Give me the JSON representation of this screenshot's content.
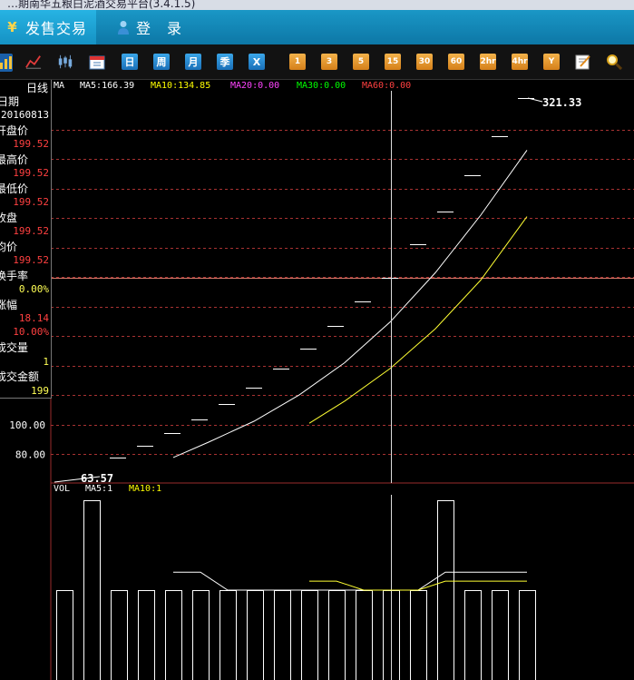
{
  "window": {
    "title": "…期南华五粮白泥酒交易平台(3.4.1.5)"
  },
  "tabs": [
    {
      "label": "发售交易",
      "icon": "yen-icon",
      "active": true
    },
    {
      "label": "登　录",
      "icon": "user-icon",
      "active": false
    }
  ],
  "toolbar": {
    "icons": [
      "bar-chart-icon",
      "line-chart-icon",
      "candlestick-icon",
      "calendar-icon"
    ],
    "period_buttons": [
      "日",
      "周",
      "月",
      "季",
      "X"
    ],
    "minute_buttons": [
      "1",
      "3",
      "5",
      "15",
      "30",
      "60",
      "2hr",
      "4hr",
      "Y"
    ],
    "tail_icons": [
      "edit-icon",
      "search-icon"
    ]
  },
  "info_panel": {
    "period": "日线",
    "fields": [
      {
        "label": "日期",
        "value": "20160813",
        "color": "white"
      },
      {
        "label": "开盘价",
        "value": "199.52",
        "color": "red"
      },
      {
        "label": "最高价",
        "value": "199.52",
        "color": "red"
      },
      {
        "label": "最低价",
        "value": "199.52",
        "color": "red"
      },
      {
        "label": "收盘",
        "value": "199.52",
        "color": "red"
      },
      {
        "label": "均价",
        "value": "199.52",
        "color": "red"
      },
      {
        "label": "换手率",
        "value": "0.00%",
        "color": "yellow"
      },
      {
        "label": "涨幅",
        "value": "18.14",
        "sub": "10.00%",
        "color": "red"
      },
      {
        "label": "成交量",
        "value": "1",
        "color": "yellow"
      },
      {
        "label": "成交金额",
        "value": "199",
        "color": "yellow"
      }
    ]
  },
  "ma_legend": [
    {
      "label": "MA",
      "color": "#ffffff"
    },
    {
      "label": "MA5:166.39",
      "color": "#ffffff"
    },
    {
      "label": "MA10:134.85",
      "color": "#ffff00"
    },
    {
      "label": "MA20:0.00",
      "color": "#ff44ff"
    },
    {
      "label": "MA30:0.00",
      "color": "#00ff00"
    },
    {
      "label": "MA60:0.00",
      "color": "#ff4040"
    }
  ],
  "vol_legend": [
    {
      "label": "VOL",
      "color": "#ffffff"
    },
    {
      "label": "MA5:1",
      "color": "#ffffff"
    },
    {
      "label": "MA10:1",
      "color": "#ffff00"
    }
  ],
  "chart_data": {
    "type": "line",
    "ylim": [
      63.57,
      321.33
    ],
    "y_ticks": [
      "80.00",
      "100.00"
    ],
    "max_label": "321.33",
    "min_label": "63.57",
    "price_bars": [
      {
        "x": 130,
        "close": 77.84
      },
      {
        "x": 160,
        "close": 85.62
      },
      {
        "x": 190,
        "close": 94.18
      },
      {
        "x": 220,
        "close": 103.6
      },
      {
        "x": 250,
        "close": 113.96
      },
      {
        "x": 280,
        "close": 125.36
      },
      {
        "x": 310,
        "close": 137.9
      },
      {
        "x": 340,
        "close": 151.69
      },
      {
        "x": 370,
        "close": 166.86
      },
      {
        "x": 400,
        "close": 183.54
      },
      {
        "x": 430,
        "close": 199.52
      },
      {
        "x": 461,
        "close": 222.1
      },
      {
        "x": 491,
        "close": 244.31
      },
      {
        "x": 521,
        "close": 268.74
      },
      {
        "x": 551,
        "close": 295.61
      },
      {
        "x": 580,
        "close": 321.33
      }
    ],
    "ma5": {
      "x": [
        191,
        230,
        280,
        330,
        380,
        430,
        480,
        530,
        581
      ],
      "y": [
        77.8,
        88.2,
        102.3,
        120.2,
        142.0,
        169.5,
        203.0,
        242.0,
        286.0
      ]
    },
    "ma10": {
      "x": [
        341,
        380,
        430,
        480,
        530,
        581
      ],
      "y": [
        101.0,
        116.0,
        138.0,
        165.0,
        198.0,
        241.0
      ]
    },
    "crosshair_x": 431,
    "volume": {
      "series": [
        {
          "x": 71,
          "v": 1
        },
        {
          "x": 101,
          "v": 2
        },
        {
          "x": 131,
          "v": 1
        },
        {
          "x": 161,
          "v": 1
        },
        {
          "x": 191,
          "v": 1
        },
        {
          "x": 221,
          "v": 1
        },
        {
          "x": 251,
          "v": 1
        },
        {
          "x": 281,
          "v": 1
        },
        {
          "x": 311,
          "v": 1
        },
        {
          "x": 341,
          "v": 1
        },
        {
          "x": 371,
          "v": 1
        },
        {
          "x": 401,
          "v": 1
        },
        {
          "x": 431,
          "v": 1
        },
        {
          "x": 461,
          "v": 1
        },
        {
          "x": 491,
          "v": 2
        },
        {
          "x": 521,
          "v": 1
        },
        {
          "x": 551,
          "v": 1
        },
        {
          "x": 581,
          "v": 1
        }
      ],
      "ma5": {
        "x": [
          191,
          221,
          251,
          431,
          461,
          491,
          581
        ],
        "y": [
          1.2,
          1.2,
          1.0,
          1.0,
          1.0,
          1.2,
          1.2
        ]
      },
      "ma10": {
        "x": [
          341,
          371,
          401,
          431,
          461,
          491,
          581
        ],
        "y": [
          1.1,
          1.1,
          1.0,
          1.0,
          1.0,
          1.1,
          1.1
        ]
      }
    }
  }
}
